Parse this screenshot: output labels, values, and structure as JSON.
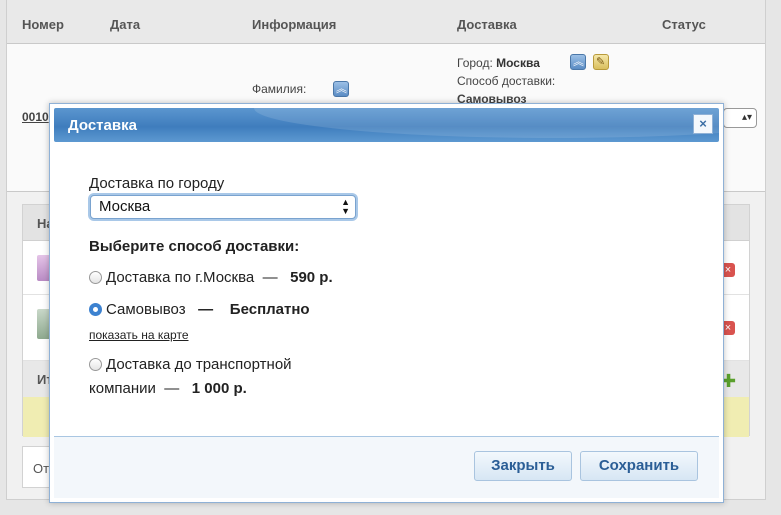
{
  "table": {
    "headers": [
      "Номер",
      "Дата",
      "Информация",
      "Доставка",
      "Статус"
    ],
    "order_number_fragment": "0010",
    "info_label": "Фамилия:",
    "delivery_city_label": "Город:",
    "delivery_city_value": "Москва",
    "delivery_method_label": "Способ доставки:",
    "delivery_method_value": "Самовывоз",
    "goods_header_fragment": "На",
    "total_fragment": "Ит",
    "bottom_fragment": "От"
  },
  "modal": {
    "title": "Доставка",
    "close_symbol": "×",
    "city_label": "Доставка по городу",
    "city_selected": "Москва",
    "choose_title": "Выберите способ доставки:",
    "options": [
      {
        "label": "Доставка по г.Москва",
        "dash": "—",
        "price": "590 р.",
        "checked": false
      },
      {
        "label": "Самовывоз",
        "dash": "—",
        "price": "Бесплатно",
        "checked": true
      },
      {
        "label_line1": "Доставка до транспортной",
        "label_line2": "компании",
        "dash": "—",
        "price": "1 000 р.",
        "checked": false
      }
    ],
    "map_link": "показать на карте",
    "buttons": {
      "close": "Закрыть",
      "save": "Сохранить"
    }
  },
  "colors": {
    "title_bar": "#3f7dbd",
    "button_text": "#2b5e96",
    "radio_checked": "#3d82d0"
  }
}
